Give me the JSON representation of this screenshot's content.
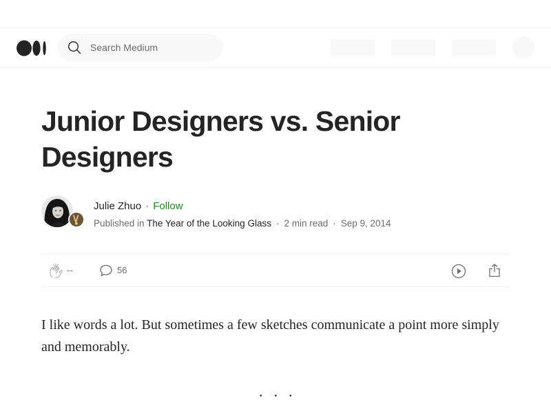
{
  "header": {
    "logo": "medium-logo",
    "search": {
      "placeholder": "Search Medium",
      "icon": "search-icon"
    }
  },
  "article": {
    "title": "Junior Designers vs. Senior Designers",
    "author": {
      "name": "Julie Zhuo",
      "follow_label": "Follow",
      "separator": "·"
    },
    "meta": {
      "published_in_label": "Published in",
      "publication": "The Year of the Looking Glass",
      "read_time": "2 min read",
      "date": "Sep 9, 2014",
      "separator": "·"
    },
    "actions": {
      "clap_count": "--",
      "comment_count": "56",
      "icons": [
        "clap-icon",
        "comment-icon",
        "play-icon",
        "share-icon"
      ]
    },
    "body": "I like words a lot. But sometimes a few sketches communicate a point more simply and memorably.",
    "section_break": "..."
  },
  "colors": {
    "text": "#242424",
    "muted": "#6b6b6b",
    "follow": "#1a8917",
    "divider": "#f2f2f2",
    "search_bg": "#f9f9f9"
  }
}
